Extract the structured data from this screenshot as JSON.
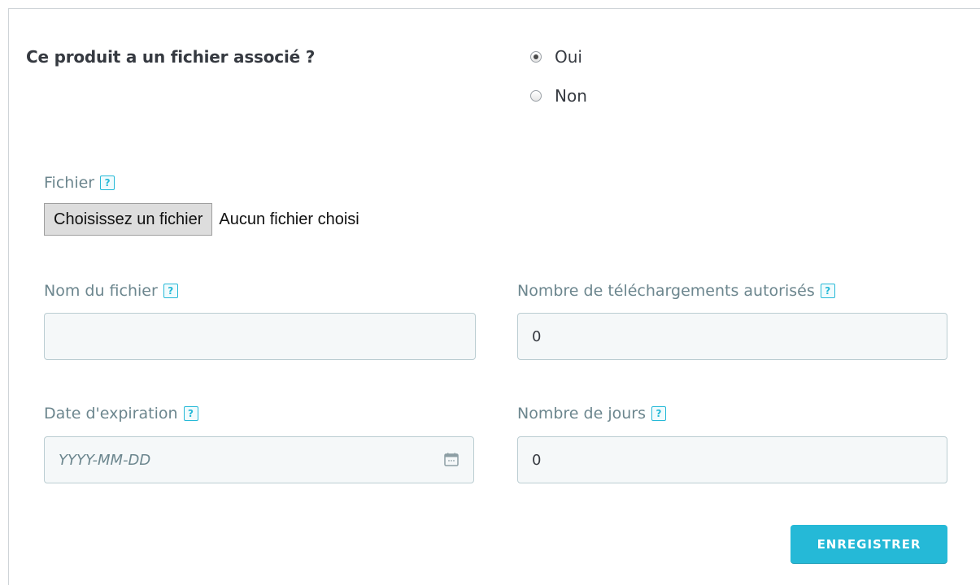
{
  "question": "Ce produit a un fichier associé ?",
  "radio_options": [
    {
      "label": "Oui",
      "checked": true
    },
    {
      "label": "Non",
      "checked": false
    }
  ],
  "file": {
    "label": "Fichier",
    "button_label": "Choisissez un fichier",
    "status": "Aucun fichier choisi"
  },
  "filename": {
    "label": "Nom du fichier",
    "value": ""
  },
  "downloads": {
    "label": "Nombre de téléchargements autorisés",
    "value": "0"
  },
  "expiration": {
    "label": "Date d'expiration",
    "placeholder": "YYYY-MM-DD"
  },
  "days": {
    "label": "Nombre de jours",
    "value": "0"
  },
  "help_glyph": "?",
  "save_label": "ENREGISTRER",
  "colors": {
    "accent": "#25b9d7",
    "label": "#6c868e",
    "text": "#363a41"
  }
}
